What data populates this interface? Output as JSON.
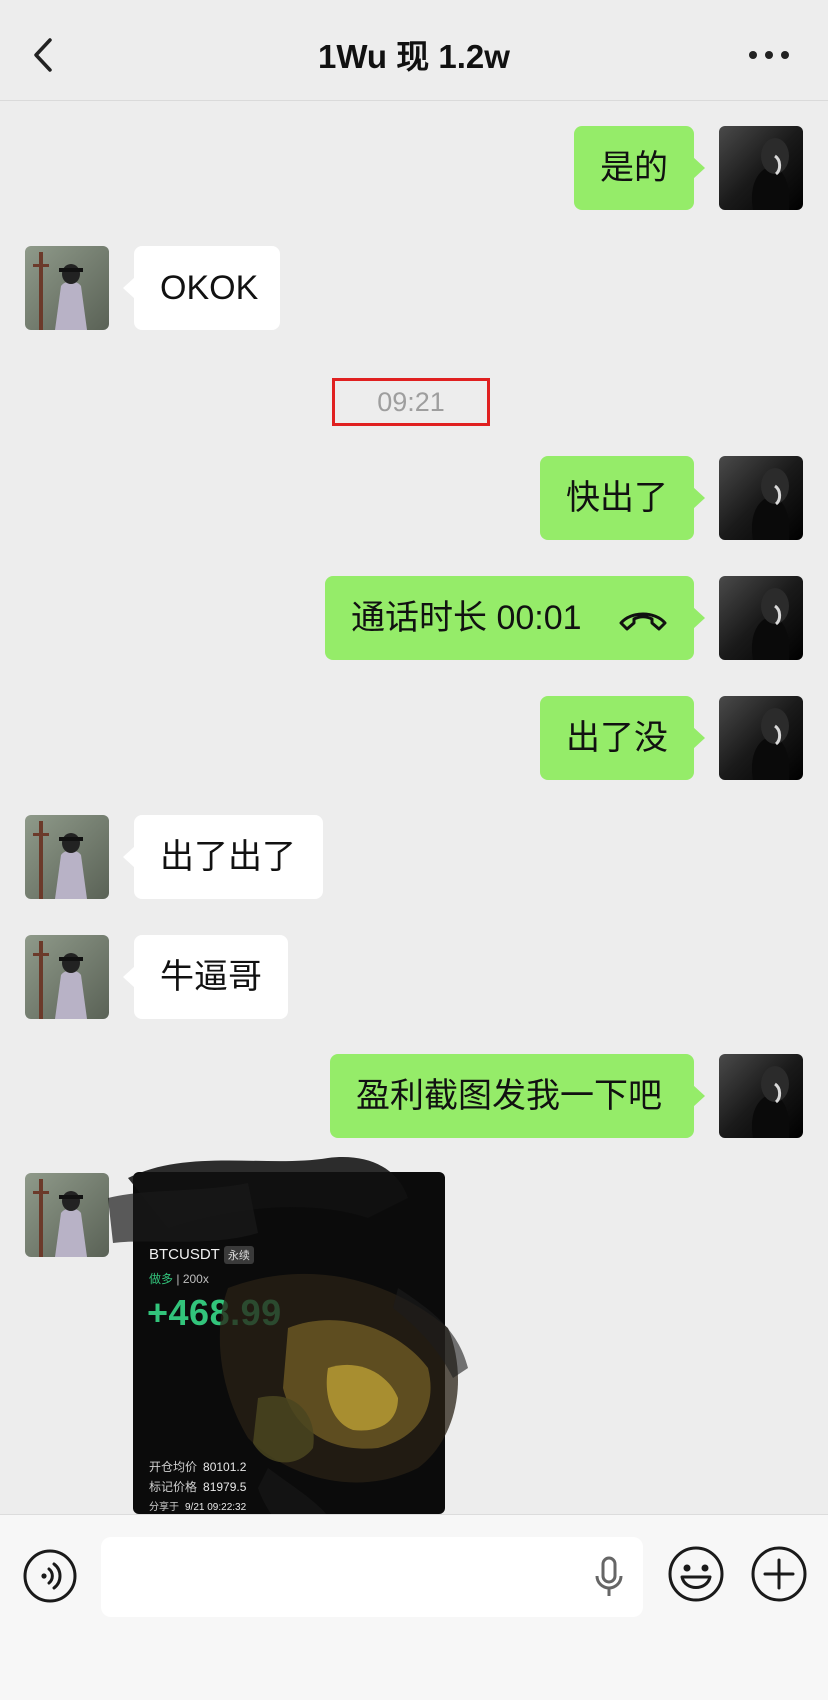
{
  "header": {
    "title": "1Wu 现 1.2w"
  },
  "timestamp": "09:21",
  "messages": {
    "m1": "是的",
    "m2": "OKOK",
    "m3": "快出了",
    "m4": "通话时长 00:01",
    "m5": "出了没",
    "m6": "出了出了",
    "m7": "牛逼哥",
    "m8": "盈利截图发我一下吧"
  },
  "trade_card": {
    "symbol": "BTCUSDT",
    "tag": "永续",
    "side": "做多",
    "leverage": "200x",
    "pnl": "+468.99",
    "entry_label": "开仓均价",
    "entry_value": "80101.2",
    "mark_label": "标记价格",
    "mark_value": "81979.5",
    "share_label": "分享于",
    "share_value": "9/21 09:22:32"
  },
  "icons": {
    "back": "chevron-left-icon",
    "more": "more-dots-icon",
    "voice": "voice-mode-icon",
    "mic": "microphone-icon",
    "emoji": "emoji-icon",
    "plus": "plus-icon",
    "call": "phone-hangup-icon"
  },
  "colors": {
    "out_bubble": "#95ec69",
    "in_bubble": "#ffffff",
    "background": "#ededed",
    "timestamp_box": "#e02020"
  }
}
